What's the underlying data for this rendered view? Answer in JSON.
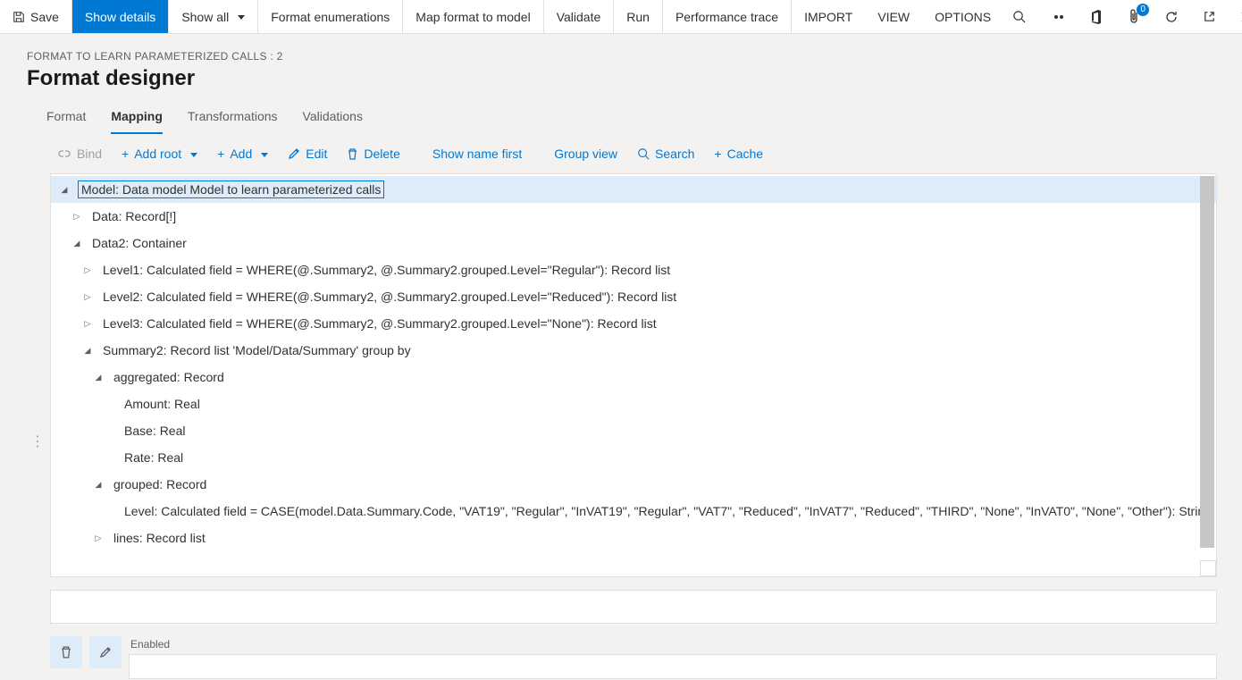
{
  "cmdbar": {
    "save": "Save",
    "show_details": "Show details",
    "show_all": "Show all",
    "format_enum": "Format enumerations",
    "map_format": "Map format to model",
    "validate": "Validate",
    "run": "Run",
    "perf_trace": "Performance trace",
    "import": "IMPORT",
    "view": "VIEW",
    "options": "OPTIONS",
    "notif_count": "0"
  },
  "breadcrumb": "FORMAT TO LEARN PARAMETERIZED CALLS : 2",
  "page_title": "Format designer",
  "tabs": {
    "format": "Format",
    "mapping": "Mapping",
    "transformations": "Transformations",
    "validations": "Validations"
  },
  "actions": {
    "bind": "Bind",
    "add_root": "Add root",
    "add": "Add",
    "edit": "Edit",
    "delete": "Delete",
    "show_name_first": "Show name first",
    "group_view": "Group view",
    "search": "Search",
    "cache": "Cache"
  },
  "tree": {
    "n0": "Model: Data model Model to learn parameterized calls",
    "n1": "Data: Record[!]",
    "n2": "Data2: Container",
    "n3": "Level1: Calculated field = WHERE(@.Summary2, @.Summary2.grouped.Level=\"Regular\"): Record list",
    "n4": "Level2: Calculated field = WHERE(@.Summary2, @.Summary2.grouped.Level=\"Reduced\"): Record list",
    "n5": "Level3: Calculated field = WHERE(@.Summary2, @.Summary2.grouped.Level=\"None\"): Record list",
    "n6": "Summary2: Record list 'Model/Data/Summary' group by",
    "n7": "aggregated: Record",
    "n8": "Amount: Real",
    "n9": "Base: Real",
    "n10": "Rate: Real",
    "n11": "grouped: Record",
    "n12": "Level: Calculated field = CASE(model.Data.Summary.Code, \"VAT19\", \"Regular\", \"InVAT19\", \"Regular\", \"VAT7\", \"Reduced\", \"InVAT7\", \"Reduced\", \"THIRD\", \"None\", \"InVAT0\", \"None\", \"Other\"): String",
    "n13": "lines: Record list"
  },
  "bottom": {
    "enabled_label": "Enabled"
  }
}
